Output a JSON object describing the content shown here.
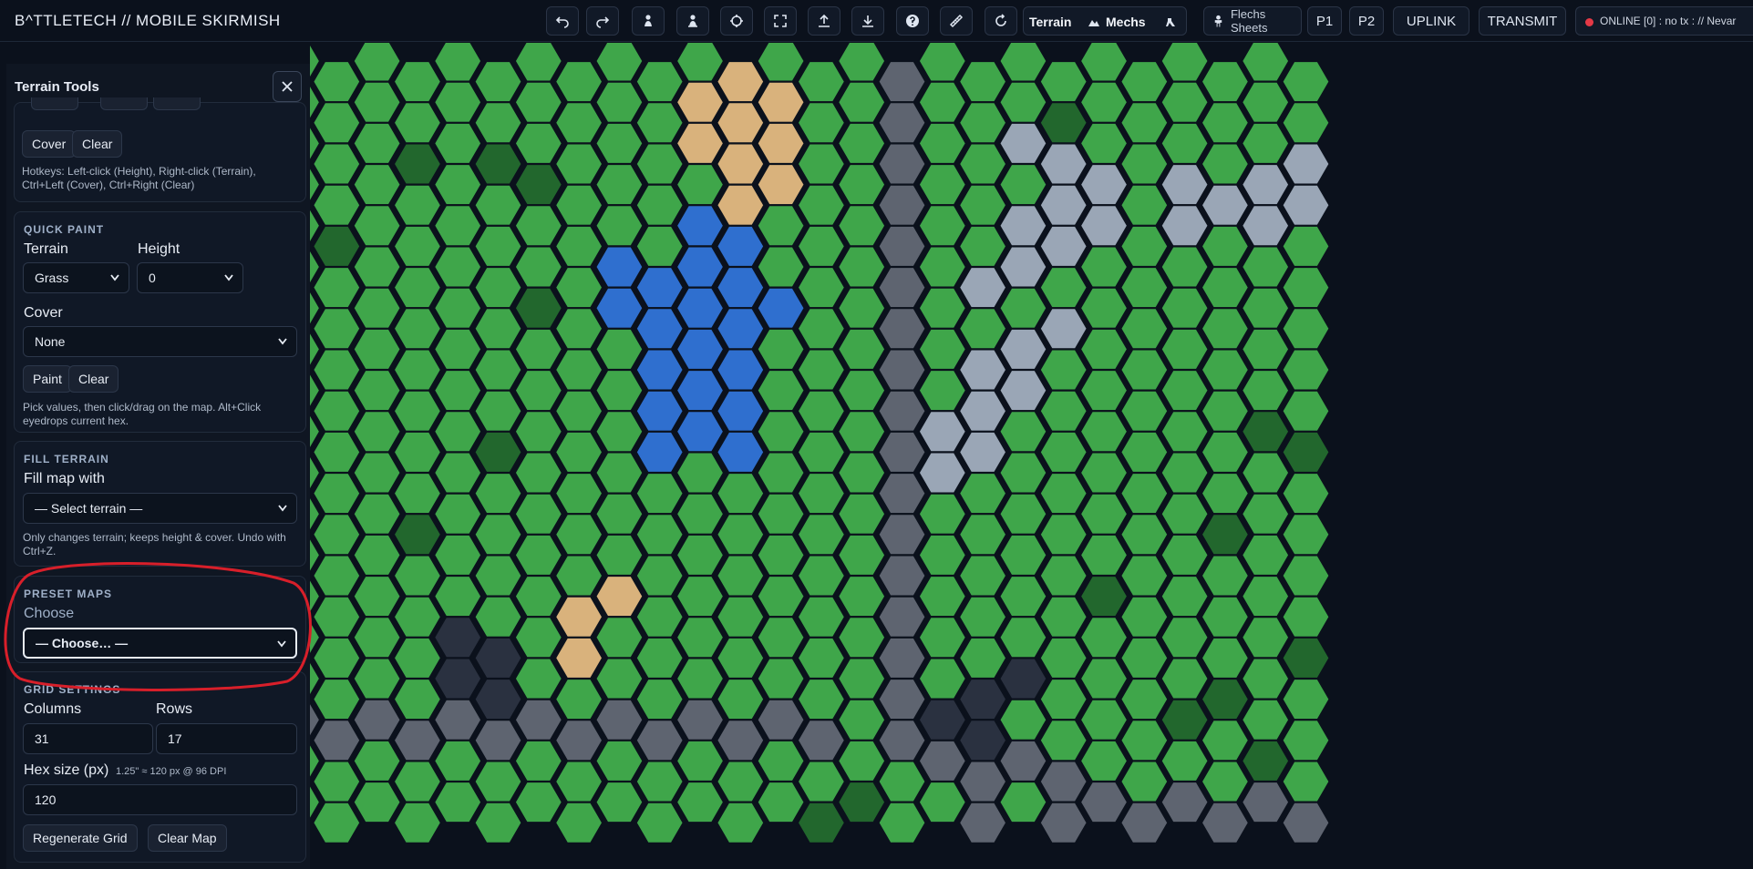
{
  "app": {
    "title": "B^TTLETECH  //  MOBILE SKIRMISH"
  },
  "toolbar": {
    "icons": [
      "undo-icon",
      "redo-icon",
      "pawn-icon",
      "pawn-alt-icon",
      "target-icon",
      "fullscreen-icon",
      "upload-icon",
      "download-icon",
      "help-icon",
      "ruler-icon",
      "rotate-icon"
    ],
    "mode_terrain": "Terrain",
    "mode_mechs": "Mechs",
    "flechs_label": "Flechs Sheets",
    "p1_label": "P1",
    "p2_label": "P2",
    "uplink_label": "UPLINK",
    "transmit_label": "TRANSMIT",
    "status_text": "ONLINE [0] : no tx : // Nevar",
    "status_color": "#e53946"
  },
  "sidebar": {
    "title": "Terrain Tools",
    "top_panel": {
      "cover_button": "Cover",
      "clear_button": "Clear",
      "hint": "Hotkeys: Left-click (Height), Right-click (Terrain), Ctrl+Left (Cover), Ctrl+Right (Clear)"
    },
    "quick_paint": {
      "title": "QUICK PAINT",
      "terrain_label": "Terrain",
      "terrain_value": "Grass",
      "height_label": "Height",
      "height_value": "0",
      "cover_label": "Cover",
      "cover_value": "None",
      "paint_button": "Paint",
      "clear_button": "Clear",
      "hint": "Pick values, then click/drag on the map. Alt+Click eyedrops current hex."
    },
    "fill_terrain": {
      "title": "FILL TERRAIN",
      "label": "Fill map with",
      "select_value": "— Select terrain —",
      "hint": "Only changes terrain; keeps height & cover. Undo with Ctrl+Z."
    },
    "preset_maps": {
      "title": "PRESET MAPS",
      "label": "Choose",
      "select_value": "— Choose… —"
    },
    "grid_settings": {
      "title": "GRID SETTINGS",
      "columns_label": "Columns",
      "columns_value": "31",
      "rows_label": "Rows",
      "rows_value": "17",
      "hex_size_label": "Hex size (px)",
      "hex_size_note": "1.25\" ≈ 120 px @ 96 DPI",
      "hex_size_value": "120",
      "regenerate_button": "Regenerate Grid",
      "clear_map_button": "Clear Map"
    }
  },
  "map": {
    "columns": 31,
    "rows": 17,
    "terrain_colors": {
      "Grass": "#3fa64a",
      "Water": "#2f6fcf",
      "Sand": "#d9b27c",
      "Rock": "#9aa6b6",
      "Asphalt": "#5e6470",
      "Urban": "#2a3140",
      "DarkGrass": "#22672d"
    },
    "terrain_labels": {
      "Grass": "Grass",
      "Water": "Water",
      "Sand": "Sand",
      "Rock": "Rock",
      "Asphalt": "Asphalt",
      "Urban": "Urban"
    },
    "sand": [
      "11:0",
      "10:1",
      "11:1",
      "12:1",
      "10:2",
      "11:2",
      "12:2",
      "11:3",
      "12:3",
      "7:13",
      "8:13",
      "7:14"
    ],
    "water": [
      "10:4",
      "11:4",
      "8:5",
      "9:5",
      "10:5",
      "11:5",
      "8:6",
      "9:6",
      "10:6",
      "11:6",
      "12:6",
      "9:7",
      "10:7",
      "11:7",
      "9:8",
      "10:8",
      "11:8",
      "9:9",
      "10:9",
      "11:9"
    ],
    "rock": [
      "18:2",
      "19:2",
      "19:3",
      "20:3",
      "18:4",
      "19:4",
      "20:4",
      "22:3",
      "22:4",
      "23:3",
      "24:3",
      "24:4",
      "25:3",
      "25:2",
      "26:2",
      "27:3",
      "28:1",
      "17:5",
      "18:5",
      "19:6",
      "18:7",
      "17:7",
      "17:8",
      "18:8",
      "17:9",
      "16:9",
      "16:10",
      "11:22",
      "12:22",
      "10:23",
      "11:23",
      "12:23",
      "13:22",
      "10:24",
      "11:24",
      "12:24",
      "13:24",
      "13:23"
    ],
    "asphalt": [
      "15:0",
      "15:1",
      "15:2",
      "15:3",
      "15:4",
      "15:5",
      "15:6",
      "15:7",
      "15:8",
      "15:9",
      "15:10",
      "15:11",
      "15:12",
      "15:13",
      "15:14",
      "15:15",
      "15:16",
      "0:16",
      "1:16",
      "2:16",
      "3:16",
      "4:16",
      "5:16",
      "6:16",
      "7:16",
      "8:16",
      "9:16",
      "10:16",
      "11:16",
      "12:16",
      "13:16",
      "16:17",
      "17:17",
      "17:18",
      "18:17",
      "19:17",
      "19:18",
      "20:18",
      "21:18",
      "22:18",
      "23:18",
      "24:18",
      "25:18",
      "26:18",
      "27:18",
      "28:17",
      "29:18",
      "30:18",
      "26:19",
      "27:19",
      "28:19",
      "29:19"
    ],
    "urban": [
      "4:14",
      "5:14",
      "4:15",
      "5:15",
      "17:15",
      "17:16",
      "18:15",
      "16:16",
      "27:21",
      "28:20",
      "29:21",
      "28:21"
    ],
    "darkgrass": [
      "1:4",
      "3:2",
      "6:6",
      "23:11",
      "27:13",
      "4:20",
      "8:22",
      "21:20",
      "17:21",
      "2:19",
      "5:9",
      "24:9",
      "25:9",
      "26:9",
      "12:19",
      "13:18",
      "14:18",
      "8:21",
      "9:21",
      "27:8",
      "25:14",
      "23:15",
      "26:16",
      "24:17",
      "28:12",
      "29:14",
      "30:15",
      "3:11",
      "1:21",
      "6:3",
      "5:2",
      "19:1",
      "20:13",
      "22:16",
      "26:3"
    ]
  }
}
